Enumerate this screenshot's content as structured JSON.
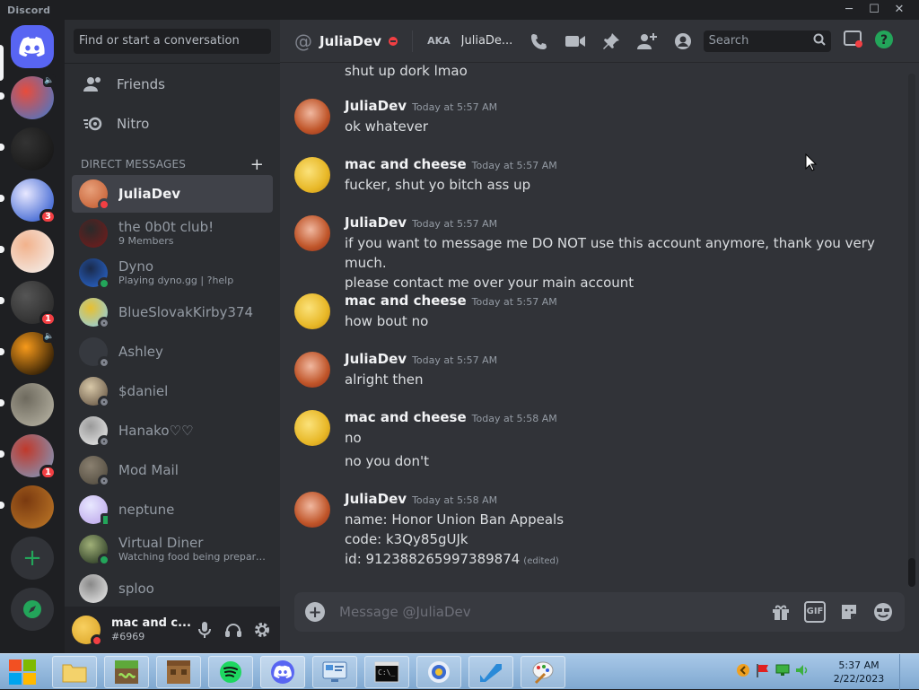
{
  "window": {
    "title": "Discord",
    "controls": [
      "─",
      "☐",
      "✕"
    ]
  },
  "servers": [
    {
      "name": "server-1",
      "colors": [
        "#3a7bd5",
        "#e74c3c"
      ],
      "badge": "",
      "top_icon": "🔈",
      "unread": true
    },
    {
      "name": "server-2",
      "colors": [
        "#111",
        "#333"
      ],
      "badge": "",
      "top_icon": "",
      "unread": true
    },
    {
      "name": "server-3",
      "colors": [
        "#1848c8",
        "#e8e8ff"
      ],
      "badge": "3",
      "top_icon": "",
      "unread": true
    },
    {
      "name": "server-4",
      "colors": [
        "#f4f4f4",
        "#f2b28c"
      ],
      "badge": "",
      "top_icon": "",
      "unread": true
    },
    {
      "name": "server-5",
      "colors": [
        "#222",
        "#555"
      ],
      "badge": "1",
      "top_icon": "",
      "unread": true
    },
    {
      "name": "server-6",
      "colors": [
        "#000",
        "#f79a1b"
      ],
      "badge": "",
      "top_icon": "🔈",
      "unread": true
    },
    {
      "name": "server-7",
      "colors": [
        "#bcb8a8",
        "#6e6a5e"
      ],
      "badge": "",
      "top_icon": "",
      "unread": true
    },
    {
      "name": "server-8",
      "colors": [
        "#7aa0c8",
        "#c0392b"
      ],
      "badge": "1",
      "top_icon": "",
      "unread": true
    },
    {
      "name": "server-9",
      "colors": [
        "#c07a28",
        "#7a3a10"
      ],
      "badge": "",
      "top_icon": "",
      "unread": true
    }
  ],
  "sidebar": {
    "search_placeholder": "Find or start a conversation",
    "nav": [
      {
        "label": "Friends",
        "icon": "friends-icon"
      },
      {
        "label": "Nitro",
        "icon": "nitro-icon"
      }
    ],
    "dm_header": "DIRECT MESSAGES",
    "dm_add": "+",
    "dms": [
      {
        "name": "JuliaDev",
        "sub": "",
        "status": "dnd",
        "colors": [
          "#c0562a",
          "#e8a07a"
        ],
        "active": true
      },
      {
        "name": "the 0b0t club!",
        "sub": "9 Members",
        "status": "",
        "colors": [
          "#7a1a1a",
          "#2a2a2a"
        ],
        "active": false
      },
      {
        "name": "Dyno",
        "sub": "Playing dyno.gg | ?help",
        "status": "on",
        "colors": [
          "#2a6ad8",
          "#1a2a4a"
        ],
        "active": false
      },
      {
        "name": "BlueSlovakKirby374",
        "sub": "",
        "status": "off",
        "colors": [
          "#8ad0f0",
          "#e8c030"
        ],
        "active": false
      },
      {
        "name": "Ashley",
        "sub": "",
        "status": "off",
        "colors": [
          "#36393f",
          "#36393f"
        ],
        "active": false
      },
      {
        "name": "$daniel",
        "sub": "",
        "status": "off",
        "colors": [
          "#5a4a3a",
          "#d8c8a8"
        ],
        "active": false
      },
      {
        "name": "Hanako♡♡",
        "sub": "",
        "status": "off",
        "colors": [
          "#eeeeee",
          "#999999"
        ],
        "active": false
      },
      {
        "name": "Mod Mail",
        "sub": "",
        "status": "off",
        "colors": [
          "#4a4438",
          "#8a8070"
        ],
        "active": false
      },
      {
        "name": "neptune",
        "sub": "",
        "status": "mobile",
        "colors": [
          "#b8a0e8",
          "#e8e8ff"
        ],
        "active": false
      },
      {
        "name": "Virtual Diner",
        "sub": "Watching food being prepared!",
        "status": "on",
        "colors": [
          "#1a2a18",
          "#a0b078"
        ],
        "active": false
      },
      {
        "name": "sploo",
        "sub": "",
        "status": "",
        "colors": [
          "#eeeeee",
          "#888888"
        ],
        "active": false
      }
    ]
  },
  "user": {
    "name": "mac and c...",
    "tag": "#6969"
  },
  "header": {
    "at": "@",
    "title": "JuliaDev",
    "aka_label": "AKA",
    "aka_name": "JuliaDe...",
    "search_placeholder": "Search"
  },
  "messages": [
    {
      "author": "",
      "time": "",
      "lines": [
        "shut up dork lmao"
      ],
      "avatar": "",
      "top": 0
    },
    {
      "author": "JuliaDev",
      "time": "Today at 5:57 AM",
      "lines": [
        "ok whatever"
      ],
      "avatar": "julia"
    },
    {
      "author": "mac and cheese",
      "time": "Today at 5:57 AM",
      "lines": [
        "fucker, shut yo bitch ass up"
      ],
      "avatar": "mac"
    },
    {
      "author": "JuliaDev",
      "time": "Today at 5:57 AM",
      "lines": [
        "if you want to message me DO NOT use this account anymore, thank you very much.",
        "please contact me over your main account"
      ],
      "avatar": "julia"
    },
    {
      "author": "mac and cheese",
      "time": "Today at 5:57 AM",
      "lines": [
        "how bout no"
      ],
      "avatar": "mac"
    },
    {
      "author": "JuliaDev",
      "time": "Today at 5:57 AM",
      "lines": [
        "alright then"
      ],
      "avatar": "julia"
    },
    {
      "author": "mac and cheese",
      "time": "Today at 5:58 AM",
      "lines": [
        "no",
        "no you don't"
      ],
      "avatar": "mac"
    },
    {
      "author": "JuliaDev",
      "time": "Today at 5:58 AM",
      "lines": [
        "name: Honor Union Ban Appeals",
        "code: k3Qy85gUJk",
        "id: 912388265997389874"
      ],
      "avatar": "julia",
      "edited": "(edited)"
    }
  ],
  "composer": {
    "placeholder": "Message @JuliaDev",
    "gif_label": "GIF"
  },
  "taskbar": {
    "apps": [
      "file-explorer",
      "minecraft-launcher",
      "minecraft",
      "spotify",
      "discord",
      "control-panel",
      "command-prompt",
      "game",
      "fast-folder",
      "paint"
    ],
    "time": "5:37 AM",
    "date": "2/22/2023"
  },
  "colors": {
    "accent": "#5865f2",
    "dnd": "#f23f43",
    "online": "#23a55a",
    "badge": "#f23f43"
  }
}
